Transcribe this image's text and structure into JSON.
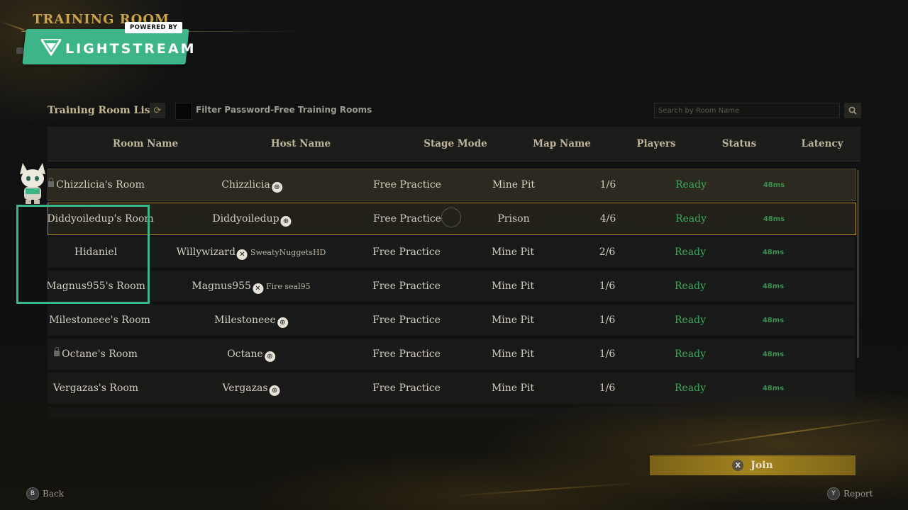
{
  "header": {
    "page_title": "TRAINING ROOM",
    "overlay_powered": "POWERED BY",
    "overlay_brand": "LIGHTSTREAM"
  },
  "toolbar": {
    "list_title": "Training Room List",
    "refresh_icon": "refresh-icon",
    "filter_label": "Filter Password-Free Training Rooms",
    "filter_checked": false,
    "search_placeholder": "Search by Room Name"
  },
  "columns": [
    "Room Name",
    "Host Name",
    "Stage Mode",
    "Map Name",
    "Players",
    "Status",
    "Latency"
  ],
  "rows": [
    {
      "room": "Chizzlicia's Room",
      "locked": true,
      "host": "Chizzlicia",
      "platform": "globe-icon",
      "gamertag": "",
      "mode": "Free Practice",
      "map": "Mine Pit",
      "players": "1/6",
      "status": "Ready",
      "latency": "48ms"
    },
    {
      "room": "Diddyoiledup's Room",
      "locked": true,
      "host": "Diddyoiledup",
      "platform": "globe-icon",
      "gamertag": "",
      "mode": "Free Practice",
      "map": "Prison",
      "players": "4/6",
      "status": "Ready",
      "latency": "48ms"
    },
    {
      "room": "Hidaniel",
      "locked": false,
      "host": "Willywizard",
      "platform": "xbox-icon",
      "gamertag": "SweatyNuggetsHD",
      "mode": "Free Practice",
      "map": "Mine Pit",
      "players": "2/6",
      "status": "Ready",
      "latency": "48ms"
    },
    {
      "room": "Magnus955's Room",
      "locked": false,
      "host": "Magnus955",
      "platform": "xbox-icon",
      "gamertag": "Fire seal95",
      "mode": "Free Practice",
      "map": "Mine Pit",
      "players": "1/6",
      "status": "Ready",
      "latency": "48ms"
    },
    {
      "room": "Milestoneee's Room",
      "locked": true,
      "host": "Milestoneee",
      "platform": "globe-icon",
      "gamertag": "",
      "mode": "Free Practice",
      "map": "Mine Pit",
      "players": "1/6",
      "status": "Ready",
      "latency": "48ms"
    },
    {
      "room": "Octane's Room",
      "locked": true,
      "host": "Octane",
      "platform": "globe-icon",
      "gamertag": "",
      "mode": "Free Practice",
      "map": "Mine Pit",
      "players": "1/6",
      "status": "Ready",
      "latency": "48ms"
    },
    {
      "room": "Vergazas's Room",
      "locked": false,
      "host": "Vergazas",
      "platform": "globe-icon",
      "gamertag": "",
      "mode": "Free Practice",
      "map": "Mine Pit",
      "players": "1/6",
      "status": "Ready",
      "latency": "48ms"
    }
  ],
  "actions": {
    "join_label": "Join",
    "join_key": "X",
    "back_label": "Back",
    "back_key": "B",
    "report_label": "Report",
    "report_key": "Y"
  },
  "colors": {
    "accent_gold": "#b8902f",
    "status_green": "#3da85a",
    "overlay_green": "#3eb489"
  }
}
